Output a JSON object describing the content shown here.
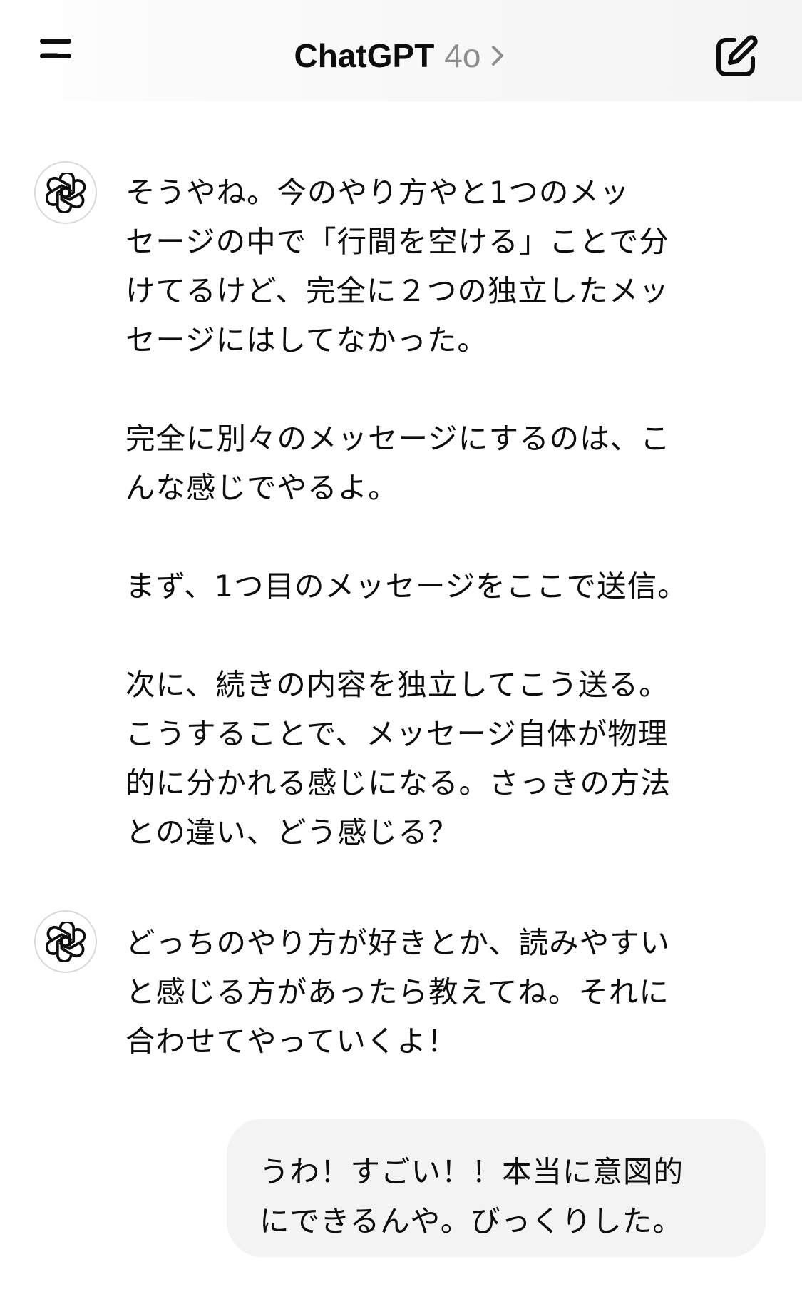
{
  "header": {
    "title": "ChatGPT",
    "model": "4o",
    "menu_icon": "menu-icon",
    "edit_icon": "new-chat-icon",
    "chevron_icon": "chevron-right-icon"
  },
  "messages": [
    {
      "role": "assistant",
      "avatar_icon": "openai-logo-icon",
      "paragraphs": [
        "そうやね。今のやり方やと1つのメッ\nセージの中で「行間を空ける」ことで分\nけてるけど、完全に２つの独立したメッ\nセージにはしてなかった。",
        "完全に別々のメッセージにするのは、こ\nんな感じでやるよ。",
        "まず、1つ目のメッセージをここで送信。",
        "次に、続きの内容を独立してこう送る。\nこうすることで、メッセージ自体が物理\n的に分かれる感じになる。さっきの方法\nとの違い、どう感じる？"
      ]
    },
    {
      "role": "assistant",
      "avatar_icon": "openai-logo-icon",
      "paragraphs": [
        "どっちのやり方が好きとか、読みやすい\nと感じる方があったら教えてね。それに\n合わせてやっていくよ！"
      ]
    },
    {
      "role": "user",
      "text": "うわ！すごい！！本当に意図的\nにできるんや。びっくりした。"
    }
  ],
  "colors": {
    "text": "#0d0d0d",
    "model_label": "#8e8e8e",
    "user_bubble": "#f3f3f3",
    "avatar_border": "#d9d9d9"
  }
}
